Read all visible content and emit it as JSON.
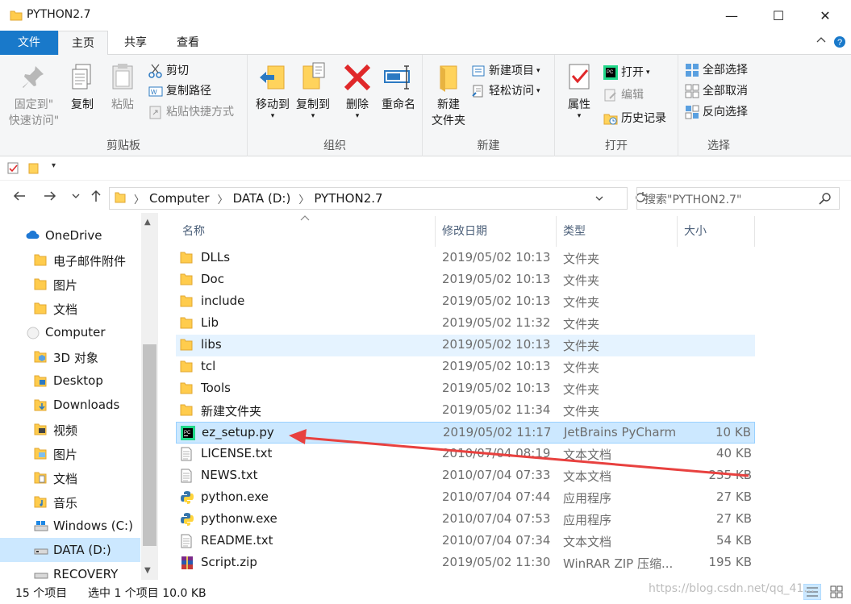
{
  "window": {
    "title": "PYTHON2.7",
    "minimize": "—",
    "maximize": "☐",
    "close": "✕"
  },
  "ribbon_tabs": [
    "文件",
    "主页",
    "共享",
    "查看"
  ],
  "ribbon": {
    "clipboard": {
      "pin_label_1": "固定到\"",
      "pin_label_2": "快速访问\"",
      "copy": "复制",
      "paste": "粘贴",
      "cut": "剪切",
      "copy_path": "复制路径",
      "paste_shortcut": "粘贴快捷方式",
      "group": "剪贴板"
    },
    "organize": {
      "move_to": "移动到",
      "copy_to": "复制到",
      "delete": "删除",
      "rename": "重命名",
      "group": "组织"
    },
    "new": {
      "new_folder_1": "新建",
      "new_folder_2": "文件夹",
      "new_item": "新建项目",
      "easy_access": "轻松访问",
      "group": "新建"
    },
    "open": {
      "properties": "属性",
      "open": "打开",
      "edit": "编辑",
      "history": "历史记录",
      "group": "打开"
    },
    "select": {
      "select_all": "全部选择",
      "select_none": "全部取消",
      "invert": "反向选择",
      "group": "选择"
    }
  },
  "address": {
    "crumbs": [
      "Computer",
      "DATA (D:)",
      "PYTHON2.7"
    ],
    "search_placeholder": "搜索\"PYTHON2.7\""
  },
  "sidebar": {
    "items": [
      {
        "label": "OneDrive",
        "icon": "cloud-icon",
        "indent": false
      },
      {
        "label": "电子邮件附件",
        "icon": "folder-icon",
        "indent": true
      },
      {
        "label": "图片",
        "icon": "folder-icon",
        "indent": true
      },
      {
        "label": "文档",
        "icon": "folder-icon",
        "indent": true
      },
      {
        "label": "Computer",
        "icon": "computer-icon",
        "indent": false
      },
      {
        "label": "3D 对象",
        "icon": "3d-objects-icon",
        "indent": true
      },
      {
        "label": "Desktop",
        "icon": "desktop-folder-icon",
        "indent": true
      },
      {
        "label": "Downloads",
        "icon": "downloads-folder-icon",
        "indent": true
      },
      {
        "label": "视频",
        "icon": "videos-folder-icon",
        "indent": true
      },
      {
        "label": "图片",
        "icon": "pictures-folder-icon",
        "indent": true
      },
      {
        "label": "文档",
        "icon": "documents-folder-icon",
        "indent": true
      },
      {
        "label": "音乐",
        "icon": "music-folder-icon",
        "indent": true
      },
      {
        "label": "Windows (C:)",
        "icon": "drive-c-icon",
        "indent": true
      },
      {
        "label": "DATA (D:)",
        "icon": "drive-d-icon",
        "indent": true,
        "selected": true
      },
      {
        "label": "RECOVERY (E:)",
        "icon": "drive-e-icon",
        "indent": true
      }
    ]
  },
  "columns": {
    "name": "名称",
    "date": "修改日期",
    "type": "类型",
    "size": "大小"
  },
  "files": [
    {
      "name": "DLLs",
      "date": "2019/05/02 10:13",
      "type": "文件夹",
      "size": "",
      "icon": "folder-icon"
    },
    {
      "name": "Doc",
      "date": "2019/05/02 10:13",
      "type": "文件夹",
      "size": "",
      "icon": "folder-icon"
    },
    {
      "name": "include",
      "date": "2019/05/02 10:13",
      "type": "文件夹",
      "size": "",
      "icon": "folder-icon"
    },
    {
      "name": "Lib",
      "date": "2019/05/02 11:32",
      "type": "文件夹",
      "size": "",
      "icon": "folder-icon"
    },
    {
      "name": "libs",
      "date": "2019/05/02 10:13",
      "type": "文件夹",
      "size": "",
      "icon": "folder-icon",
      "hover": true
    },
    {
      "name": "tcl",
      "date": "2019/05/02 10:13",
      "type": "文件夹",
      "size": "",
      "icon": "folder-icon"
    },
    {
      "name": "Tools",
      "date": "2019/05/02 10:13",
      "type": "文件夹",
      "size": "",
      "icon": "folder-icon"
    },
    {
      "name": "新建文件夹",
      "date": "2019/05/02 11:34",
      "type": "文件夹",
      "size": "",
      "icon": "folder-icon"
    },
    {
      "name": "ez_setup.py",
      "date": "2019/05/02 11:17",
      "type": "JetBrains PyCharm",
      "size": "10 KB",
      "icon": "pycharm-file-icon",
      "selected": true
    },
    {
      "name": "LICENSE.txt",
      "date": "2010/07/04 08:19",
      "type": "文本文档",
      "size": "40 KB",
      "icon": "text-file-icon"
    },
    {
      "name": "NEWS.txt",
      "date": "2010/07/04 07:33",
      "type": "文本文档",
      "size": "235 KB",
      "icon": "text-file-icon"
    },
    {
      "name": "python.exe",
      "date": "2010/07/04 07:44",
      "type": "应用程序",
      "size": "27 KB",
      "icon": "python-exe-icon"
    },
    {
      "name": "pythonw.exe",
      "date": "2010/07/04 07:53",
      "type": "应用程序",
      "size": "27 KB",
      "icon": "python-exe-icon"
    },
    {
      "name": "README.txt",
      "date": "2010/07/04 07:34",
      "type": "文本文档",
      "size": "54 KB",
      "icon": "text-file-icon"
    },
    {
      "name": "Script.zip",
      "date": "2019/05/02 11:30",
      "type": "WinRAR ZIP 压缩...",
      "size": "195 KB",
      "icon": "winrar-zip-icon"
    }
  ],
  "status": {
    "count": "15 个项目",
    "selection": "选中 1 个项目  10.0 KB"
  },
  "watermark": "https://blog.csdn.net/qq_41...",
  "colors": {
    "accent": "#1979ca",
    "selection": "#cce8ff",
    "arrow": "#e8413f"
  }
}
